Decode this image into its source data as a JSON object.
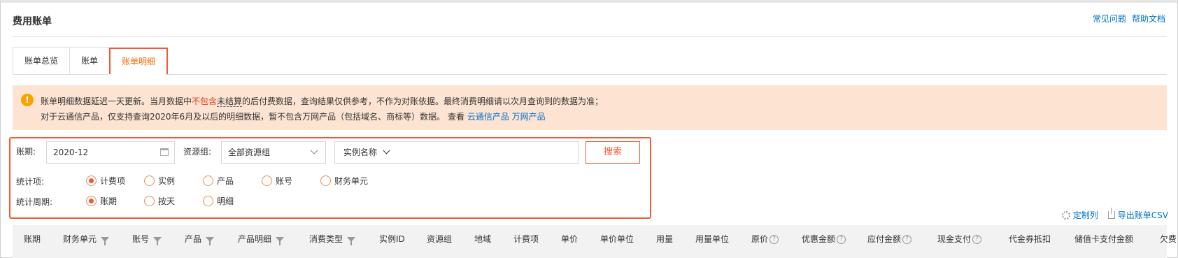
{
  "header": {
    "title": "费用账单",
    "links": [
      "常见问题",
      "帮助文档"
    ]
  },
  "tabs": [
    "账单总览",
    "账单",
    "账单明细"
  ],
  "notice": {
    "icon": "info-icon",
    "line1_a": "账单明细数据延迟一天更新。当月数据中",
    "line1_red": "不包含",
    "line1_dashed": "未结算",
    "line1_b": "的后付费数据，查询结果仅供参考，不作为对账依据。最终消费明细请以次月查询到的数据为准；",
    "line2": "对于云通信产品，仅支持查询2020年6月及以后的明细数据，暂不包含万网产品（包括域名、商标等）数据。 查看 ",
    "link1": "云通信产品",
    "link2": "万网产品"
  },
  "filters": {
    "period_label": "账期:",
    "period_value": "2020-12",
    "resgroup_label": "资源组:",
    "resgroup_value": "全部资源组",
    "instance_value": "实例名称",
    "search_label": "搜索",
    "stat_label": "统计项:",
    "stat_options": [
      "计费项",
      "实例",
      "产品",
      "账号",
      "财务单元"
    ],
    "stat_selected": "计费项",
    "period_stat_label": "统计周期:",
    "period_options": [
      "账期",
      "按天",
      "明细"
    ],
    "period_selected": "账期"
  },
  "tools": {
    "customize_cols": "定制列",
    "export_csv": "导出账单CSV"
  },
  "table": {
    "columns": [
      "账期",
      "财务单元",
      "账号",
      "产品",
      "产品明细",
      "消费类型",
      "实例ID",
      "资源组",
      "地域",
      "计费项",
      "单价",
      "单价单位",
      "用量",
      "用量单位",
      "原价",
      "优惠金额",
      "应付金额",
      "现金支付",
      "代金券抵扣",
      "储值卡支付金额",
      "欠费"
    ]
  },
  "colors": {
    "accent": "#ff6a00",
    "highlight_border": "#f25a35",
    "link": "#0070cc",
    "notice_bg": "#fde3d1"
  }
}
